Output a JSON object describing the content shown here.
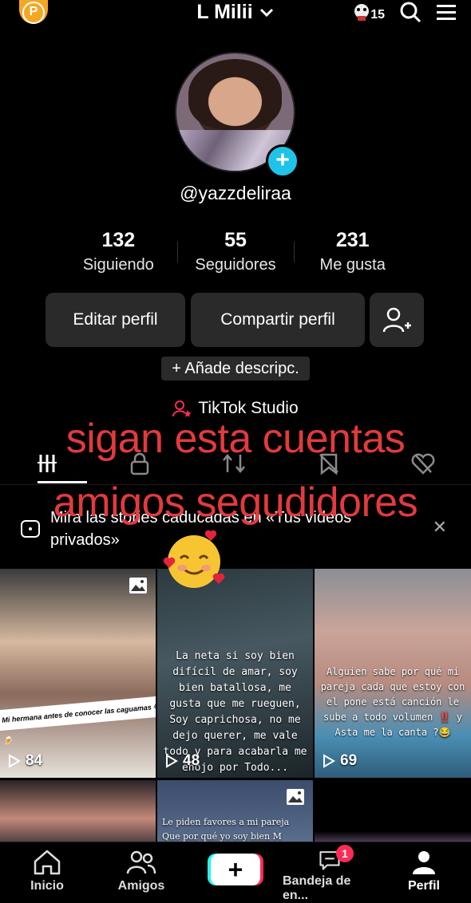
{
  "top_bar": {
    "coin_label": "P",
    "username": "L Milii",
    "notification_count": "15"
  },
  "profile": {
    "handle": "@yazzdeliraa",
    "stats": [
      {
        "value": "132",
        "label": "Siguiendo"
      },
      {
        "value": "55",
        "label": "Seguidores"
      },
      {
        "value": "231",
        "label": "Me gusta"
      }
    ],
    "edit_button": "Editar perfil",
    "share_button": "Compartir perfil",
    "add_description": "+ Añade descripc.",
    "studio_label": "TikTok Studio"
  },
  "overlay": {
    "line1": "sigan esta cuentas",
    "line2": "amigos segudidores"
  },
  "banner": {
    "text": "Mira las stories caducadas en «Tus videos privados»"
  },
  "videos": [
    {
      "plays": "84",
      "strip_text": "Mi hermana antes de conocer las caguamas 😂🍺"
    },
    {
      "plays": "48",
      "caption": "La neta si soy bien difícil de amar, soy bien batallosa, me gusta que me rueguen, Soy caprichosa, no me dejo querer, me vale todo y para acabarla me enojo por Todo..."
    },
    {
      "plays": "69",
      "caption": "Alguien sabe por qué mi pareja cada que estoy con el pone está canción le sube a todo volumen ‼️ y Asta me la canta ?😂"
    },
    {
      "plays": ""
    },
    {
      "plays": "",
      "caption": "Le piden favores a mi pareja Que por qué yo soy bien M mona 😂"
    },
    {
      "plays": ""
    }
  ],
  "bottom_nav": [
    {
      "label": "Inicio",
      "icon": "home-icon"
    },
    {
      "label": "Amigos",
      "icon": "friends-icon"
    },
    {
      "label": "+",
      "icon": "create-icon"
    },
    {
      "label": "Bandeja de en...",
      "icon": "inbox-icon",
      "badge": "1"
    },
    {
      "label": "Perfil",
      "icon": "profile-icon"
    }
  ],
  "colors": {
    "overlay_text": "#e23a3e",
    "accent_cyan": "#20c3e8",
    "tiktok_red": "#fe2c55",
    "tiktok_cyan": "#25f4ee",
    "coin": "#f5a623"
  }
}
